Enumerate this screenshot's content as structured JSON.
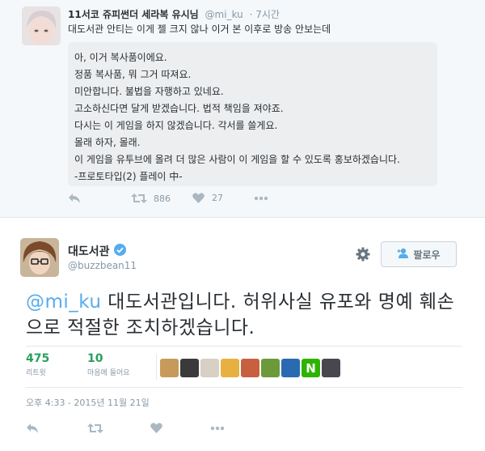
{
  "tweet1": {
    "name": "11서코 쥬피썬더 세라복 유시님",
    "handle": "@mi_ku",
    "time": "7시간",
    "text": "대도서관 안티는 이게 젤 크지 않나 이거 본 이후로 방송 안보는데",
    "quote_lines": [
      "아, 이거 복사품이에요.",
      "정품 복사품, 뭐 그거 따져요.",
      "미안합니다. 불법을 자행하고 있네요.",
      "고소하신다면 달게 받겠습니다. 법적 책임을 져야죠.",
      "다시는 이 게임을 하지 않겠습니다. 각서를 쓸게요.",
      "몰래 하자, 몰래.",
      "이 게임을 유투브에 올려 더 많은 사람이 이 게임을 할 수 있도록 홍보하겠습니다.",
      "-프로토타입(2) 플레이 中-"
    ],
    "retweets": "886",
    "likes": "27"
  },
  "tweet2": {
    "name": "대도서관",
    "handle": "@buzzbean11",
    "follow_label": "팔로우",
    "mention": "@mi_ku",
    "text": " 대도서관입니다. 허위사실 유포와 명예 훼손으로 적절한 조치하겠습니다.",
    "retweets_count": "475",
    "retweets_label": "리트윗",
    "likes_count": "10",
    "likes_label": "마음에 들어요",
    "date": "오후 4:33 - 2015년 11월 21일"
  },
  "colors": {
    "accent": "#55acee",
    "stat_green": "#2a9e5f",
    "muted": "#8899a6"
  },
  "icons": [
    "reply-icon",
    "retweet-icon",
    "like-icon",
    "more-icon",
    "verified-icon",
    "gear-icon",
    "add-user-icon"
  ]
}
